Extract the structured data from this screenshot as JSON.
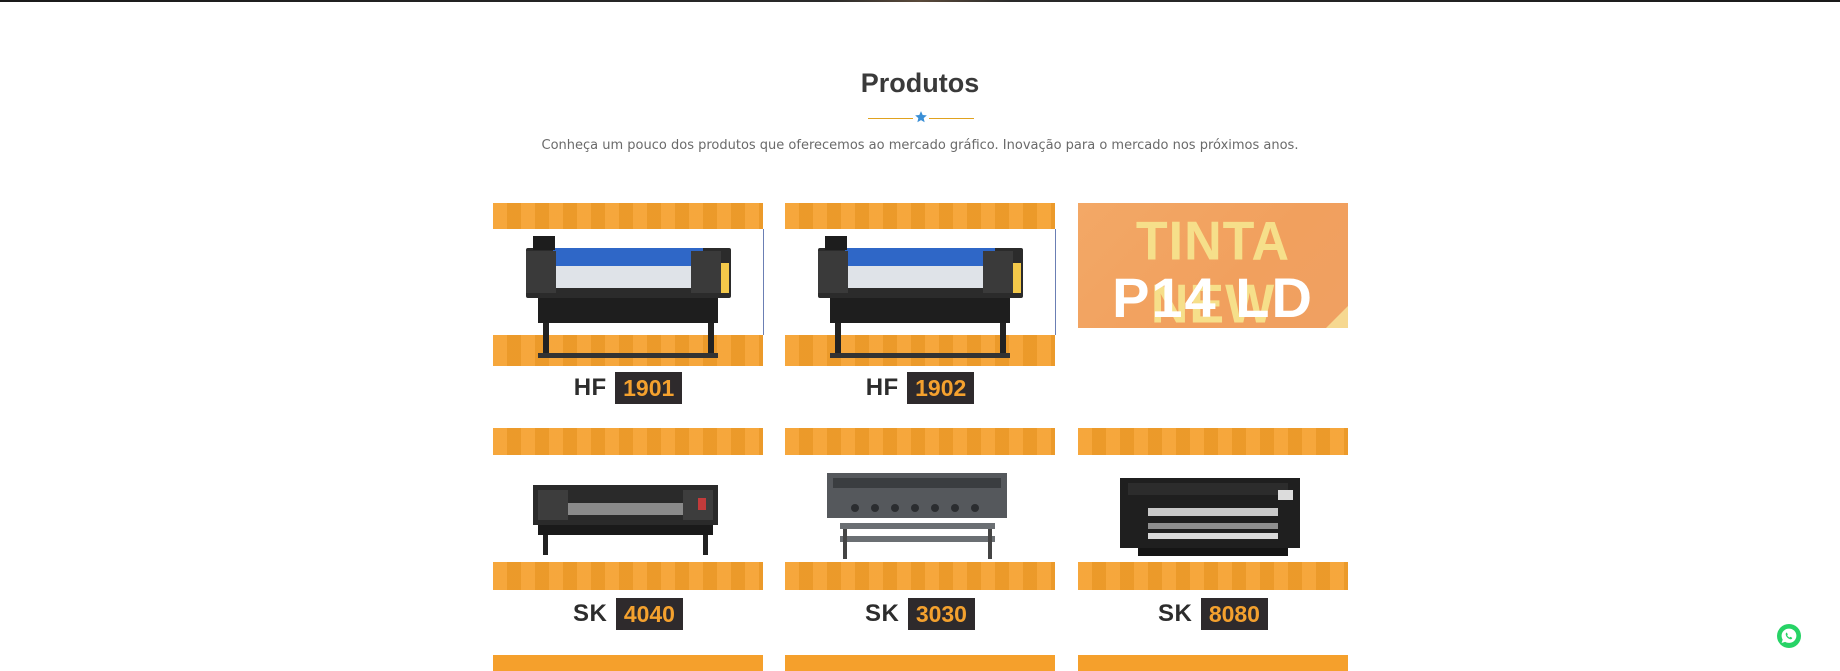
{
  "section": {
    "title": "Produtos",
    "subtitle": "Conheça um pouco dos produtos que oferecemos ao mercado gráfico. Inovação para o mercado nos próximos anos."
  },
  "products": [
    {
      "prefix": "HF",
      "number": "1901"
    },
    {
      "prefix": "HF",
      "number": "1902"
    },
    {
      "prefix": "SK",
      "number": "4040"
    },
    {
      "prefix": "SK",
      "number": "3030"
    },
    {
      "prefix": "SK",
      "number": "8080"
    }
  ],
  "promo": {
    "line1": "TINTA NEW",
    "line2": "P14 LD"
  },
  "icons": {
    "divider": "star-icon",
    "chat": "whatsapp-icon"
  },
  "colors": {
    "accent": "#f5a02c",
    "label_bg": "#2e2a2c",
    "label_text": "#f4a12e",
    "divider": "#e0a21f",
    "star": "#3a8fd6",
    "whatsapp": "#27d366"
  }
}
